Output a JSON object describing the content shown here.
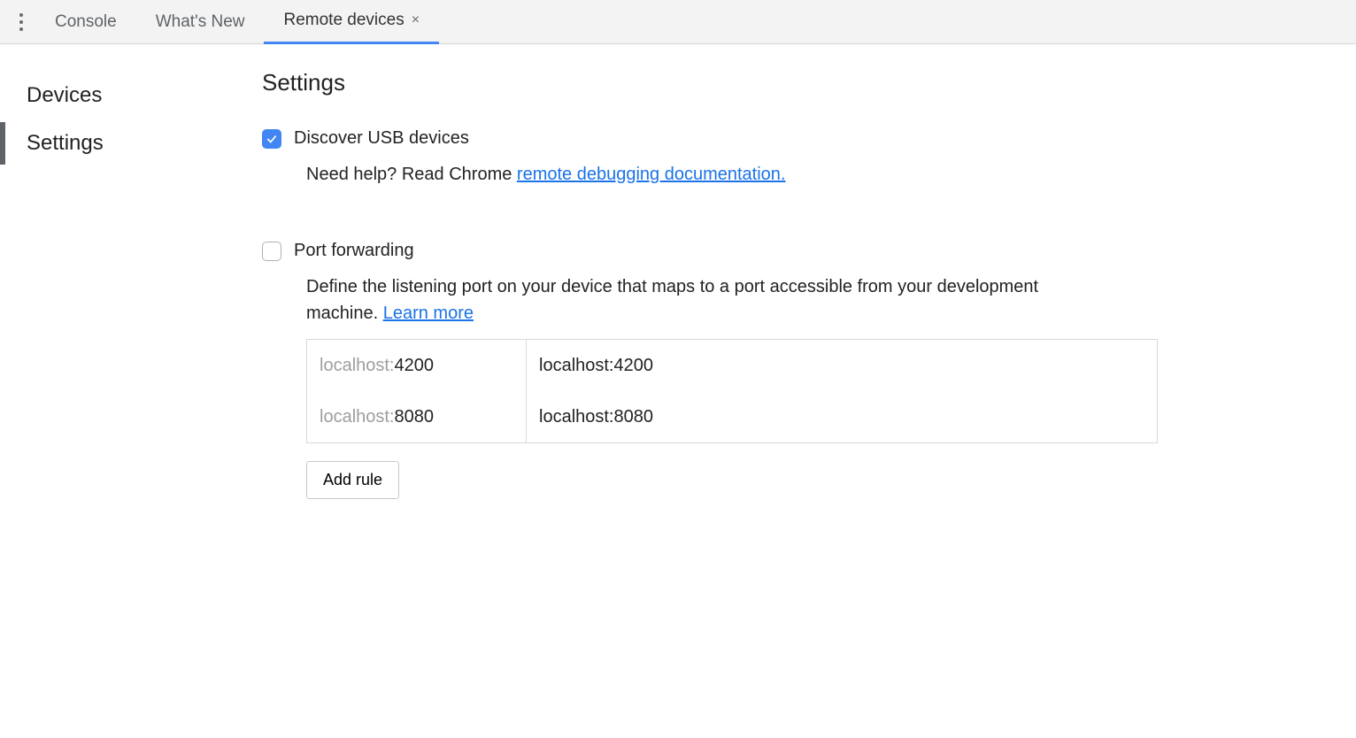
{
  "tabs": {
    "items": [
      {
        "label": "Console"
      },
      {
        "label": "What's New"
      },
      {
        "label": "Remote devices",
        "active": true,
        "closable": true
      }
    ]
  },
  "sidebar": {
    "items": [
      {
        "label": "Devices"
      },
      {
        "label": "Settings",
        "selected": true
      }
    ]
  },
  "page": {
    "title": "Settings"
  },
  "discover": {
    "checked": true,
    "label": "Discover USB devices",
    "help_prefix": "Need help? Read Chrome ",
    "help_link": "remote debugging documentation."
  },
  "port_forwarding": {
    "checked": false,
    "label": "Port forwarding",
    "desc_prefix": "Define the listening port on your device that maps to a port accessible from your development machine. ",
    "learn_more": "Learn more",
    "rules": [
      {
        "left_prefix": "localhost:",
        "left_port": "4200",
        "right": "localhost:4200"
      },
      {
        "left_prefix": "localhost:",
        "left_port": "8080",
        "right": "localhost:8080"
      }
    ],
    "add_rule_label": "Add rule"
  }
}
